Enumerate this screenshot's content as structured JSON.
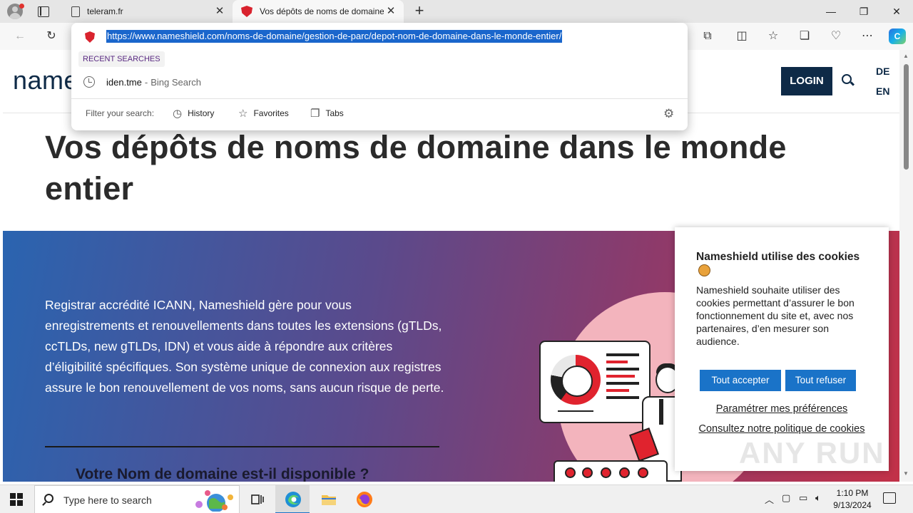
{
  "browser": {
    "tabs": [
      {
        "title": "teleram.fr",
        "close": "✕"
      },
      {
        "title": "Vos dépôts de noms de domaine",
        "close": "✕"
      }
    ],
    "new_tab": "+",
    "window_controls": {
      "minimize": "—",
      "maximize": "❐",
      "close": "✕"
    },
    "toolbar": {
      "back": "←",
      "reload": "↻",
      "more": "⋯",
      "copilot": "C"
    },
    "address_dropdown": {
      "url": "https://www.nameshield.com/noms-de-domaine/gestion-de-parc/depot-nom-de-domaine-dans-le-monde-entier/",
      "recent_label": "RECENT SEARCHES",
      "recent_item": {
        "term": "iden.tme",
        "separator": "-",
        "source": "Bing Search"
      },
      "filter_label": "Filter your search:",
      "filters": [
        "History",
        "Favorites",
        "Tabs"
      ]
    }
  },
  "page": {
    "logo": "name",
    "login": "LOGIN",
    "languages": [
      "DE",
      "EN"
    ],
    "title": "Vos dépôts de noms de domaine dans le monde entier",
    "hero_text": "Registrar accrédité ICANN, Nameshield gère pour vous enregistrements et renouvellements dans toutes les extensions (gTLDs, ccTLDs, new gTLDs, IDN) et vous aide à répondre aux critères d’éligibilité spécifiques. Son système unique de connexion aux registres assure le bon renouvellement de vos noms, sans aucun risque de perte.",
    "hero_subtitle": "Votre Nom de domaine est-il disponible ?"
  },
  "cookie_banner": {
    "title": "Nameshield utilise des cookies",
    "body": "Nameshield souhaite utiliser des cookies permettant d’assurer le bon fonctionnement du site et, avec nos partenaires, d’en mesurer son audience.",
    "accept": "Tout accepter",
    "refuse": "Tout refuser",
    "preferences": "Paramétrer mes préférences",
    "policy": "Consultez notre politique de cookies"
  },
  "watermark": "ANY RUN",
  "taskbar": {
    "search_placeholder": "Type here to search",
    "time": "1:10 PM",
    "date": "9/13/2024"
  },
  "colors": {
    "brand_navy": "#0e2a47",
    "accent_red": "#d9232e",
    "cookie_button": "#1a73c8"
  }
}
